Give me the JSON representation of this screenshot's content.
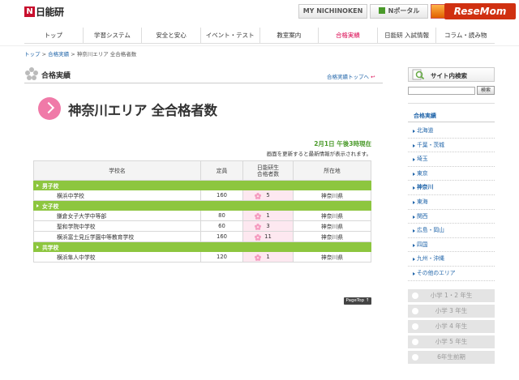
{
  "header": {
    "logo_mark": "N",
    "logo_text": "日能研",
    "tabs": [
      {
        "label": "MY NICHINOKEN"
      },
      {
        "label": "Nポータル"
      },
      {
        "label": ""
      }
    ],
    "watermark": "ReseMom"
  },
  "nav": {
    "items": [
      {
        "label": "トップ"
      },
      {
        "label": "学習システム"
      },
      {
        "label": "安全と安心"
      },
      {
        "label": "イベント・テスト"
      },
      {
        "label": "教室案内"
      },
      {
        "label": "合格実績"
      },
      {
        "label": "日能研 入試情報"
      },
      {
        "label": "コラム・読み物"
      }
    ],
    "active_index": 5
  },
  "breadcrumb": {
    "home": "トップ",
    "sep": ">",
    "parent": "合格実績",
    "current": "神奈川エリア 全合格者数"
  },
  "section": {
    "title": "合格実績",
    "top_link": "合格実績トップへ"
  },
  "page_title": "神奈川エリア 全合格者数",
  "date_stamp": "2月1日 午後3時現在",
  "update_note": "画面を更新すると最新情報が表示されます。",
  "table": {
    "headers": {
      "name": "学校名",
      "capacity": "定員",
      "count_line1": "日能研生",
      "count_line2": "合格者数",
      "location": "所在地"
    },
    "groups": [
      {
        "label": "男子校",
        "rows": [
          {
            "name": "横浜中学校",
            "capacity": "160",
            "count": "5",
            "location": "神奈川県"
          }
        ]
      },
      {
        "label": "女子校",
        "rows": [
          {
            "name": "鎌倉女子大学中等部",
            "capacity": "80",
            "count": "1",
            "location": "神奈川県"
          },
          {
            "name": "聖和学院中学校",
            "capacity": "60",
            "count": "3",
            "location": "神奈川県"
          },
          {
            "name": "横浜富士見丘学園中等教育学校",
            "capacity": "160",
            "count": "11",
            "location": "神奈川県"
          }
        ]
      },
      {
        "label": "共学校",
        "rows": [
          {
            "name": "横浜隼人中学校",
            "capacity": "120",
            "count": "1",
            "location": "神奈川県"
          }
        ]
      }
    ]
  },
  "page_top": "PageTop ↑",
  "sidebar": {
    "search_title": "サイト内検索",
    "search_button": "検索",
    "search_placeholder": "",
    "heading": "合格実績",
    "areas": [
      {
        "label": "北海道"
      },
      {
        "label": "千葉・茨城"
      },
      {
        "label": "埼玉"
      },
      {
        "label": "東京"
      },
      {
        "label": "神奈川"
      },
      {
        "label": "東海"
      },
      {
        "label": "関西"
      },
      {
        "label": "広島・岡山"
      },
      {
        "label": "四国"
      },
      {
        "label": "九州・沖縄"
      },
      {
        "label": "その他のエリア"
      }
    ],
    "current_area_index": 4,
    "grades": [
      {
        "label": "小学 1・2 年生"
      },
      {
        "label": "小学 3 年生"
      },
      {
        "label": "小学 4 年生"
      },
      {
        "label": "小学 5 年生"
      },
      {
        "label": "6年生前期"
      }
    ]
  },
  "colors": {
    "accent_pink": "#d9004c",
    "group_green": "#8dc63f",
    "date_green": "#4a9a2a",
    "link_blue": "#2266aa",
    "logo_red": "#c8102e"
  }
}
